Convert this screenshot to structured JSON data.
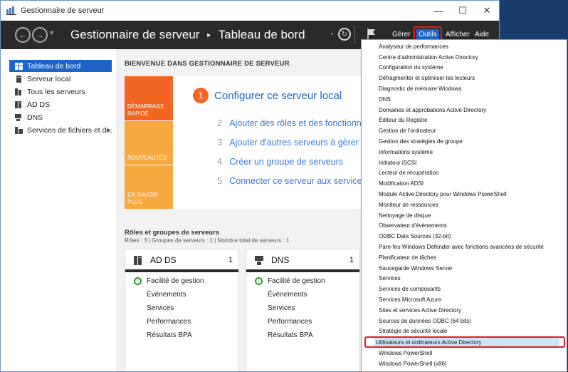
{
  "window": {
    "title": "Gestionnaire de serveur"
  },
  "header": {
    "breadcrumb_app": "Gestionnaire de serveur",
    "breadcrumb_sep": "▸",
    "breadcrumb_page": "Tableau de bord",
    "menu_manage": "Gérer",
    "menu_tools": "Outils",
    "menu_view": "Afficher",
    "menu_help": "Aide"
  },
  "sidebar": {
    "items": [
      {
        "label": "Tableau de bord",
        "icon": "dashboard-icon",
        "active": true
      },
      {
        "label": "Serveur local",
        "icon": "server-icon"
      },
      {
        "label": "Tous les serveurs",
        "icon": "servers-icon"
      },
      {
        "label": "AD DS",
        "icon": "adds-icon"
      },
      {
        "label": "DNS",
        "icon": "dns-icon"
      },
      {
        "label": "Services de fichiers et d...",
        "icon": "file-services-icon"
      }
    ]
  },
  "welcome": {
    "title": "BIENVENUE DANS GESTIONNAIRE DE SERVEUR",
    "tiles": [
      "DÉMARRAGE RAPIDE",
      "NOUVEAUTÉS",
      "EN SAVOIR PLUS"
    ],
    "step1_num": "1",
    "step1_text": "Configurer ce serveur local",
    "steps": [
      {
        "num": "2",
        "text": "Ajouter des rôles et des fonctionnal"
      },
      {
        "num": "3",
        "text": "Ajouter d'autres serveurs à gérer"
      },
      {
        "num": "4",
        "text": "Créer un groupe de serveurs"
      },
      {
        "num": "5",
        "text": "Connecter ce serveur aux services c"
      }
    ]
  },
  "roles": {
    "title": "Rôles et groupes de serveurs",
    "subtitle": "Rôles : 3   |   Groupes de serveurs : 1   |   Nombre total de serveurs : 1",
    "cards": [
      {
        "name": "AD DS",
        "count": "1",
        "rows": [
          "Facilité de gestion",
          "Événements",
          "Services",
          "Performances",
          "Résultats BPA"
        ]
      },
      {
        "name": "DNS",
        "count": "1",
        "rows": [
          "Facilité de gestion",
          "Événements",
          "Services",
          "Performances",
          "Résultats BPA"
        ]
      }
    ]
  },
  "tools_menu": {
    "items": [
      "Analyseur de performances",
      "Centre d'administration Active Directory",
      "Configuration du système",
      "Défragmenter et optimiser les lecteurs",
      "Diagnostic de mémoire Windows",
      "DNS",
      "Domaines et approbations Active Directory",
      "Éditeur du Registre",
      "Gestion de l'ordinateur",
      "Gestion des stratégies de groupe",
      "Informations système",
      "Initiateur iSCSI",
      "Lecteur de récupération",
      "Modification ADSI",
      "Module Active Directory pour Windows PowerShell",
      "Moniteur de ressources",
      "Nettoyage de disque",
      "Observateur d'événements",
      "ODBC Data Sources (32-bit)",
      "Pare-feu Windows Defender avec fonctions avancées de sécurité",
      "Planificateur de tâches",
      "Sauvegarde Windows Server",
      "Services",
      "Services de composants",
      "Services Microsoft Azure",
      "Sites et services Active Directory",
      "Sources de données ODBC (64 bits)",
      "Stratégie de sécurité locale",
      "Utilisateurs et ordinateurs Active Directory",
      "Windows PowerShell",
      "Windows PowerShell (x86)"
    ],
    "highlighted_index": 28
  },
  "colors": {
    "accent": "#1e64c8",
    "orange": "#f26522",
    "light_orange": "#f7a83e",
    "highlight_border": "#e02020"
  }
}
